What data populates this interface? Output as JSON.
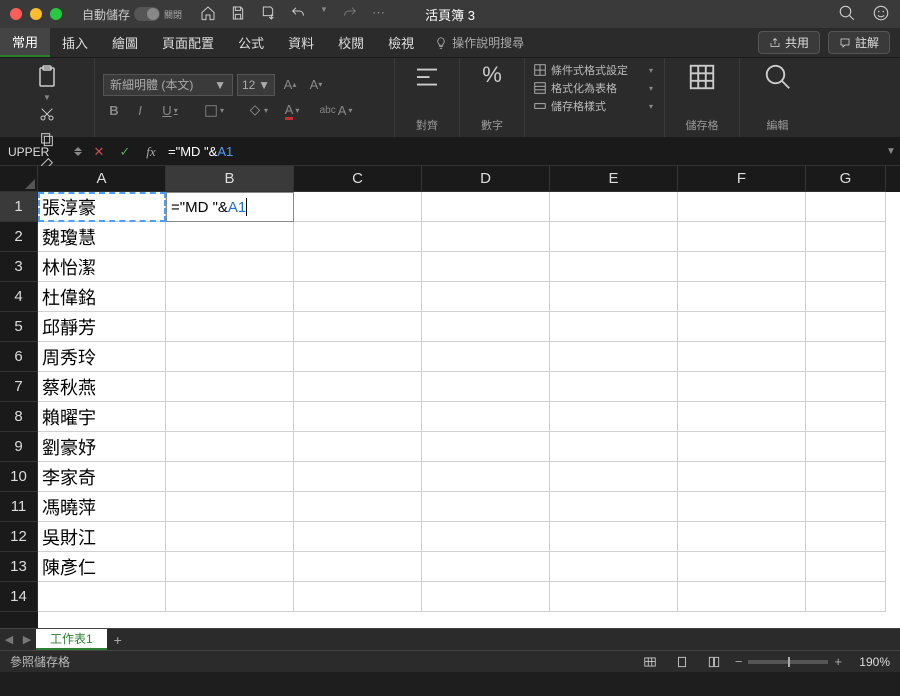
{
  "titlebar": {
    "autosave_label": "自動儲存",
    "autosave_state": "關閉",
    "window_title": "活頁簿 3"
  },
  "tabs": {
    "items": [
      "常用",
      "插入",
      "繪圖",
      "頁面配置",
      "公式",
      "資料",
      "校閱",
      "檢視"
    ],
    "tellme": "操作說明搜尋",
    "share": "共用",
    "comments": "註解"
  },
  "ribbon": {
    "paste_label": "貼上",
    "font_name": "新細明體 (本文)",
    "font_size": "12",
    "align_label": "對齊",
    "number_label": "數字",
    "cond_fmt": "條件式格式設定",
    "fmt_table": "格式化為表格",
    "cell_styles": "儲存格樣式",
    "cells_group": "儲存格",
    "editing_group": "編輯"
  },
  "formula_bar": {
    "name_box": "UPPER",
    "formula_prefix": "=\"MD \"&",
    "formula_ref": "A1"
  },
  "grid": {
    "columns": [
      "A",
      "B",
      "C",
      "D",
      "E",
      "F",
      "G"
    ],
    "row_count": 14,
    "active_row": 1,
    "active_col": "B",
    "column_a": [
      "張淳豪",
      "魏瓊慧",
      "林怡潔",
      "杜偉銘",
      "邱靜芳",
      "周秀玲",
      "蔡秋燕",
      "賴曜宇",
      "劉豪妤",
      "李家奇",
      "馮曉萍",
      "吳財江",
      "陳彥仁"
    ],
    "b1_display_prefix": "=\"MD \"&",
    "b1_display_ref": "A1"
  },
  "sheet_tabs": {
    "sheet1": "工作表1"
  },
  "status": {
    "mode": "參照儲存格",
    "zoom": "190%"
  }
}
